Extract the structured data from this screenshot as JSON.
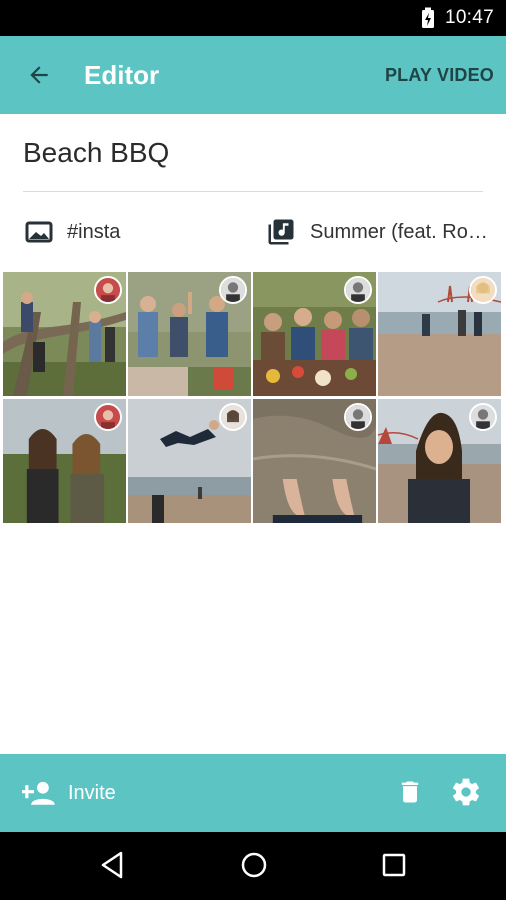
{
  "status": {
    "time": "10:47",
    "battery_icon": "battery-charging-icon"
  },
  "app_bar": {
    "title": "Editor",
    "action_label": "PLAY VIDEO",
    "back_icon": "arrow-back-icon"
  },
  "event": {
    "title": "Beach BBQ"
  },
  "meta": {
    "filter_label": "#insta",
    "filter_icon": "photo-frame-icon",
    "music_label": "Summer (feat. Ro…",
    "music_icon": "music-library-icon"
  },
  "grid": {
    "columns": 4,
    "photos": [
      {
        "scene": "kids climbing a tree in a park",
        "avatar": "avatar-woman-red"
      },
      {
        "scene": "group high-fiving at a picnic",
        "avatar": "avatar-man-bw"
      },
      {
        "scene": "friends sitting at a picnic table with food",
        "avatar": "avatar-man-bw"
      },
      {
        "scene": "people jumping on the beach near the bridge",
        "avatar": "avatar-woman-blonde"
      },
      {
        "scene": "two women smiling outdoors",
        "avatar": "avatar-woman-red"
      },
      {
        "scene": "man flipping in the air on the beach",
        "avatar": "avatar-woman-dark"
      },
      {
        "scene": "bare feet in the surf",
        "avatar": "avatar-man-bw"
      },
      {
        "scene": "woman smiling on the beach with the bridge behind",
        "avatar": "avatar-man-bw"
      }
    ]
  },
  "bottom_bar": {
    "invite_label": "Invite",
    "invite_icon": "person-add-icon",
    "delete_icon": "trash-icon",
    "settings_icon": "gear-icon"
  },
  "nav": {
    "back_icon": "nav-back-icon",
    "home_icon": "nav-home-icon",
    "recents_icon": "nav-recents-icon"
  },
  "colors": {
    "accent": "#5cc5c4",
    "play_text": "#1f4445",
    "status_bg": "#000000"
  }
}
